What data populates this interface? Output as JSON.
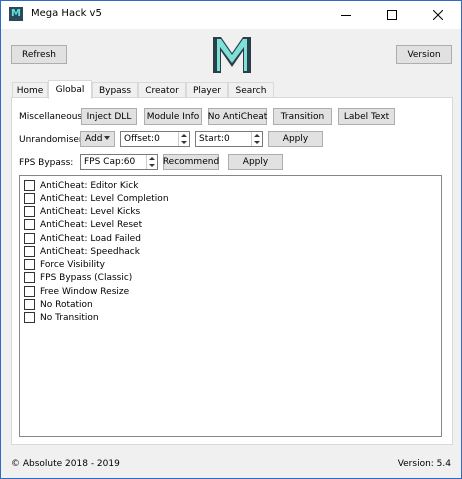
{
  "window": {
    "title": "Mega Hack v5",
    "app_icon_glyph": "M"
  },
  "toolbar": {
    "refresh_label": "Refresh",
    "version_label": "Version"
  },
  "tabs": [
    "Home",
    "Global",
    "Bypass",
    "Creator",
    "Player",
    "Search"
  ],
  "active_tab": "Global",
  "miscellaneous": {
    "label": "Miscellaneous:",
    "buttons": [
      "Inject DLL",
      "Module Info",
      "No AntiCheat",
      "Transition",
      "Label Text"
    ]
  },
  "unrandomiser": {
    "label": "Unrandomiser:",
    "mode_value": "Add",
    "offset_value": "Offset:0",
    "start_value": "Start:0",
    "apply_label": "Apply"
  },
  "fps_bypass": {
    "label": "FPS Bypass:",
    "cap_value": "FPS Cap:60",
    "recommend_label": "Recommend",
    "apply_label": "Apply"
  },
  "options": [
    "AntiCheat: Editor Kick",
    "AntiCheat: Level Completion",
    "AntiCheat: Level Kicks",
    "AntiCheat: Level Reset",
    "AntiCheat: Load Failed",
    "AntiCheat: Speedhack",
    "Force Visibility",
    "FPS Bypass (Classic)",
    "Free Window Resize",
    "No Rotation",
    "No Transition"
  ],
  "footer": {
    "copyright": "© Absolute 2018 - 2019",
    "version": "Version: 5.4"
  },
  "colors": {
    "logo_teal": "#7fe0d8",
    "logo_dark": "#2a3f4a",
    "accent": "#0078d7"
  }
}
